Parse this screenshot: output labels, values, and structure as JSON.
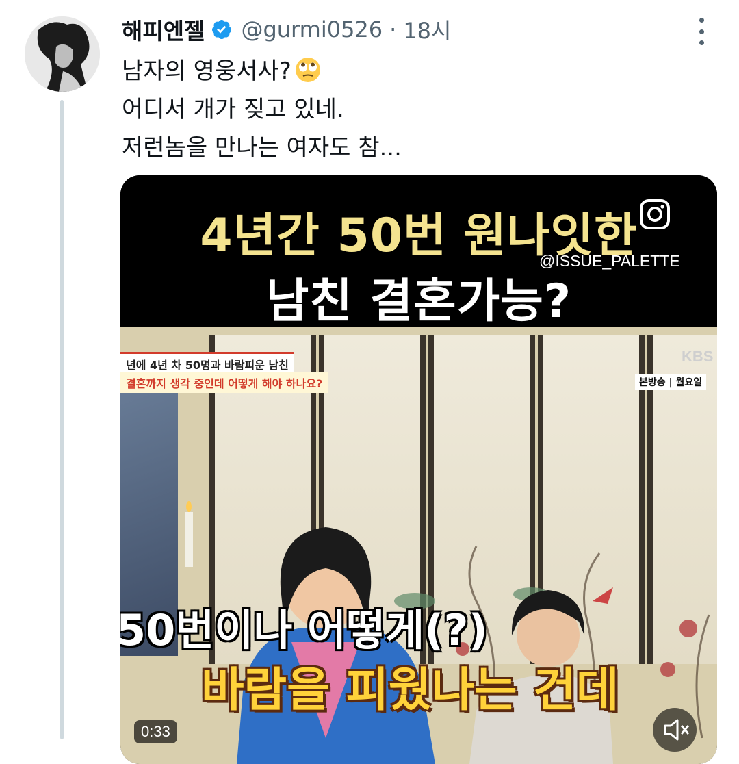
{
  "tweet": {
    "author_name": "해피엔젤",
    "handle": "@gurmi0526",
    "separator": "·",
    "time": "18시",
    "lines": [
      "남자의 영웅서사?",
      "어디서 개가 짖고 있네.",
      "저런놈을 만나는 여자도 참..."
    ],
    "emoji_name": "face-with-rolling-eyes-icon"
  },
  "video": {
    "title_line1": "4년간 50번 원나잇한",
    "title_line2": "남친 결혼가능?",
    "watermark": "@ISSUE_PALETTE",
    "caption_top_line1": "년에 4년 차 50명과 바람피운 남친",
    "caption_top_line2": "결혼까지 생각 중인데 어떻게 해야 하나요?",
    "channel_logo": "KBS",
    "broadcast_tag": "본방송 | 월요일",
    "subtitle_line1": "50번이나 어떻게(?)",
    "subtitle_line2": "바람을 피웠나는 건데",
    "time_label": "0:33"
  },
  "colors": {
    "verified_blue": "#1d9bf0",
    "title_yellow": "#f4e38f",
    "subtitle_yellow": "#ffd23a",
    "caption_red": "#d23b2b"
  }
}
